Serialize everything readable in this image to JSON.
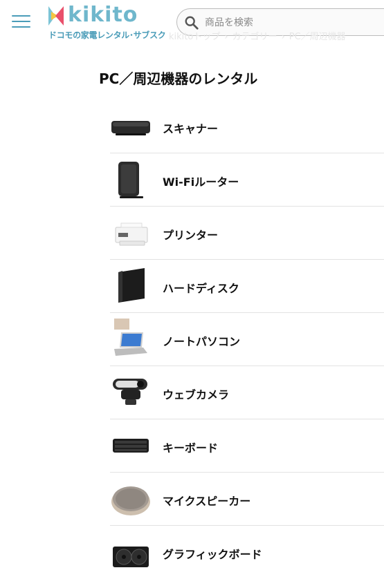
{
  "header": {
    "logo_text": "kikito",
    "logo_tagline": "ドコモの家電レンタル･サブスク",
    "search_placeholder": "商品を検索"
  },
  "breadcrumb": [
    "kikitoトップ",
    "カテゴリー",
    "PC／周辺機器"
  ],
  "breadcrumb_sep": "›",
  "page_title": "PC／周辺機器のレンタル",
  "categories": [
    {
      "label": "スキャナー",
      "icon": "scanner-icon"
    },
    {
      "label": "Wi-Fiルーター",
      "icon": "wifi-router-icon"
    },
    {
      "label": "プリンター",
      "icon": "printer-icon"
    },
    {
      "label": "ハードディスク",
      "icon": "hard-disk-icon"
    },
    {
      "label": "ノートパソコン",
      "icon": "laptop-icon"
    },
    {
      "label": "ウェブカメラ",
      "icon": "webcam-icon"
    },
    {
      "label": "キーボード",
      "icon": "keyboard-icon"
    },
    {
      "label": "マイクスピーカー",
      "icon": "speakerphone-icon"
    },
    {
      "label": "グラフィックボード",
      "icon": "graphics-card-icon"
    }
  ],
  "colors": {
    "brand": "#6fb7cc",
    "brand_dark": "#4a9cb8"
  }
}
